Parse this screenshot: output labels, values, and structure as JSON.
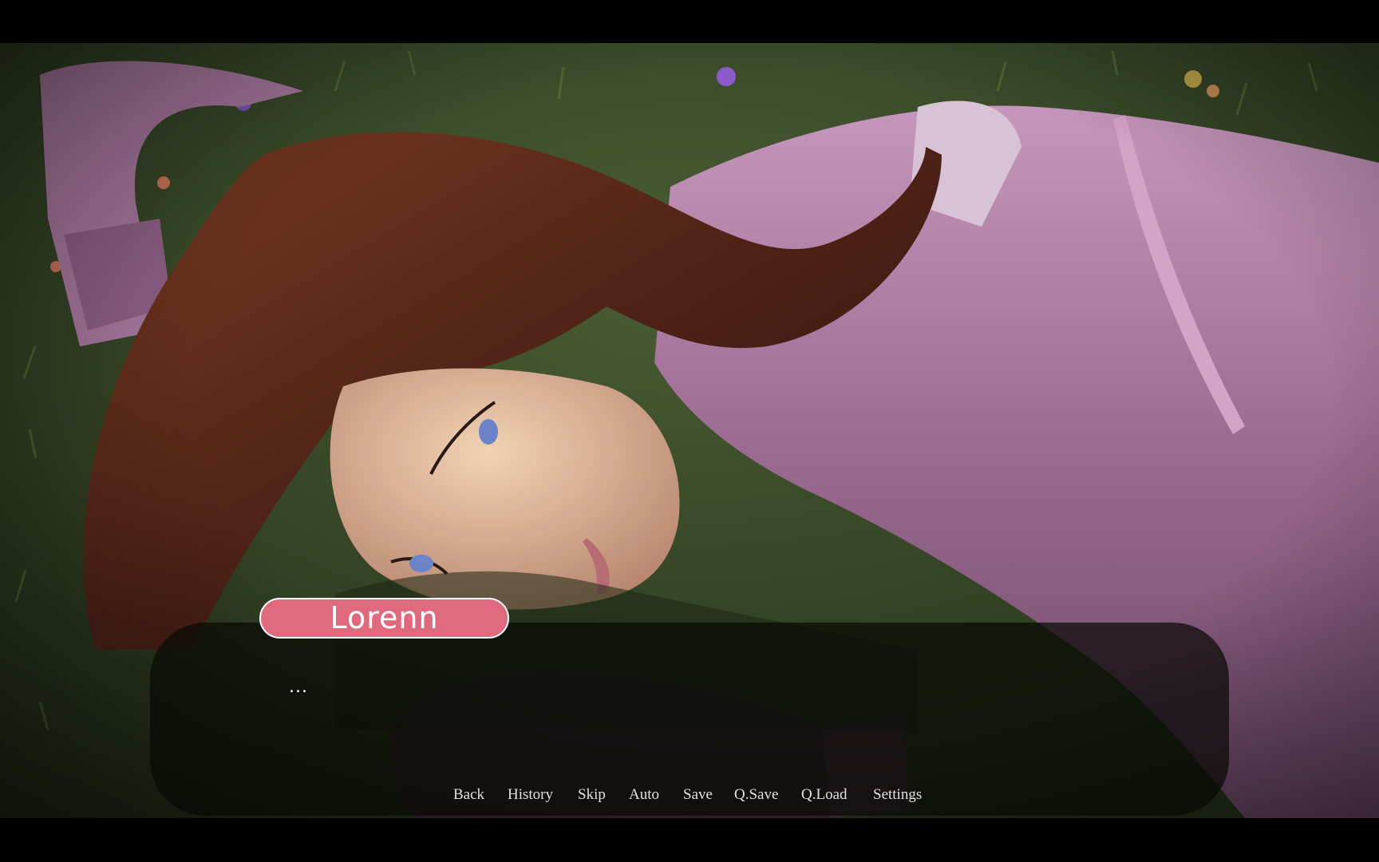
{
  "character": {
    "name": "Lorenn"
  },
  "dialogue": {
    "text": "..."
  },
  "quick_menu": {
    "back": "Back",
    "history": "History",
    "skip": "Skip",
    "auto": "Auto",
    "save": "Save",
    "qsave": "Q.Save",
    "qload": "Q.Load",
    "settings": "Settings"
  },
  "colors": {
    "namebox_fill": "#e06a7d",
    "namebox_border": "#ffffff",
    "letterbox": "#000000",
    "textbox": "rgba(8,10,6,0.72)",
    "grass": "#3a4b2a",
    "sweater": "#b784ad",
    "hair": "#5a2a1c",
    "skin": "#e8c2a6"
  }
}
